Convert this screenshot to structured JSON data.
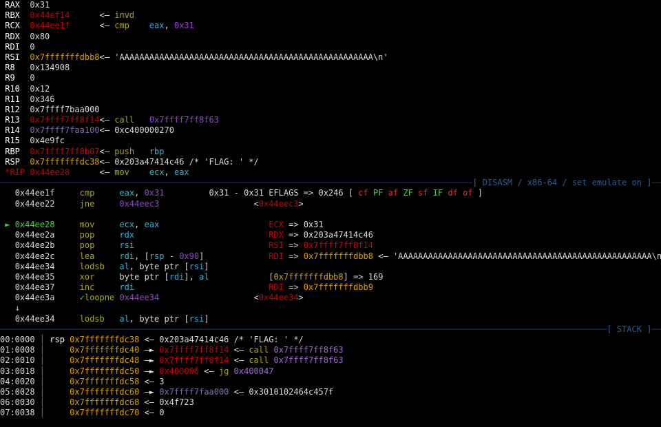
{
  "terminal": {
    "title": "pwndbg context view",
    "background": "#000000",
    "foreground": "#d8d8d8",
    "colors": {
      "red": "#cc0000",
      "bright_red": "#ff2222",
      "green": "#4ca64c",
      "bright_green": "#33dd33",
      "yellow": "#c4a000",
      "olive": "#a8a800",
      "blue": "#3465a4",
      "cyan": "#2fb3d9",
      "purple": "#9a3fd4",
      "dim_purple": "#7c6fa8",
      "separator": "#1e3a5f"
    }
  },
  "registers": {
    "rows": [
      {
        "name": "RAX",
        "value": "0x31",
        "value_color": "white",
        "arrow": "",
        "annotation": ""
      },
      {
        "name": "RBX",
        "value": "0x44ef14",
        "value_color": "red",
        "arrow": "<—",
        "annotation": "invd"
      },
      {
        "name": "RCX",
        "value": "0x44ee1f",
        "value_color": "red",
        "arrow": "<—",
        "annotation": "cmp    eax, 0x31"
      },
      {
        "name": "RDX",
        "value": "0x80",
        "value_color": "white",
        "arrow": "",
        "annotation": ""
      },
      {
        "name": "RDI",
        "value": "0",
        "value_color": "white",
        "arrow": "",
        "annotation": ""
      },
      {
        "name": "RSI",
        "value": "0x7fffffffdbb8",
        "value_color": "yellow",
        "arrow": "<—",
        "annotation": "'AAAAAAAAAAAAAAAAAAAAAAAAAAAAAAAAAAAAAAAAAAAAAAAAAAA\\n'"
      },
      {
        "name": "R8",
        "value": "0x134908",
        "value_color": "white",
        "arrow": "",
        "annotation": ""
      },
      {
        "name": "R9",
        "value": "0",
        "value_color": "white",
        "arrow": "",
        "annotation": ""
      },
      {
        "name": "R10",
        "value": "0x12",
        "value_color": "white",
        "arrow": "",
        "annotation": ""
      },
      {
        "name": "R11",
        "value": "0x346",
        "value_color": "white",
        "arrow": "",
        "annotation": ""
      },
      {
        "name": "R12",
        "value": "0x7ffff7baa000",
        "value_color": "white",
        "arrow": "",
        "annotation": ""
      },
      {
        "name": "R13",
        "value": "0x7ffff7ff8f14",
        "value_color": "red",
        "arrow": "<—",
        "annotation": "call   0x7ffff7ff8f63"
      },
      {
        "name": "R14",
        "value": "0x7ffff7faa100",
        "value_color": "dim_purple",
        "arrow": "<—",
        "annotation": "0xc400000270"
      },
      {
        "name": "R15",
        "value": "0x4e9fc",
        "value_color": "white",
        "arrow": "",
        "annotation": ""
      },
      {
        "name": "RBP",
        "value": "0x7ffff7ff8b07",
        "value_color": "red",
        "arrow": "<—",
        "annotation": "push   rbp"
      },
      {
        "name": "RSP",
        "value": "0x7fffffffdc38",
        "value_color": "yellow",
        "arrow": "<—",
        "annotation": "0x203a47414c46 /* 'FLAG: ' */"
      },
      {
        "name": "*RIP",
        "value": "0x44ee28",
        "value_color": "red",
        "arrow": "<—",
        "annotation": "mov    ecx, eax"
      }
    ]
  },
  "disasm": {
    "section_label": "[ DISASM / x86-64 / set emulate on ]",
    "eflags": {
      "label": "EFLAGS =>",
      "value": "0x246",
      "flags": [
        {
          "name": "cf",
          "set": false
        },
        {
          "name": "PF",
          "set": true
        },
        {
          "name": "af",
          "set": false
        },
        {
          "name": "ZF",
          "set": true
        },
        {
          "name": "sf",
          "set": false
        },
        {
          "name": "IF",
          "set": true
        },
        {
          "name": "df",
          "set": false
        },
        {
          "name": "of",
          "set": false
        }
      ]
    },
    "lines": [
      {
        "marker": "",
        "address": "0x44ee1f",
        "mnemonic": "cmp",
        "operands": "eax, 0x31",
        "comment": "0x31 - 0x31",
        "annotation": "EFLAGS",
        "current": false,
        "taken": false,
        "spacer_before": false
      },
      {
        "marker": "",
        "address": "0x44ee22",
        "mnemonic": "jne",
        "operands": "0x44eec3",
        "comment": "",
        "annotation": "<0x44eec3>",
        "current": false,
        "taken": false,
        "spacer_before": false
      },
      {
        "marker": "►",
        "address": "0x44ee28",
        "mnemonic": "mov",
        "operands": "ecx, eax",
        "comment": "",
        "annotation": "ECX => 0x31",
        "current": true,
        "taken": false,
        "spacer_before": true
      },
      {
        "marker": "",
        "address": "0x44ee2a",
        "mnemonic": "pop",
        "operands": "rdx",
        "comment": "",
        "annotation": "RDX => 0x203a47414c46",
        "current": false,
        "taken": false,
        "spacer_before": false
      },
      {
        "marker": "",
        "address": "0x44ee2b",
        "mnemonic": "pop",
        "operands": "rsi",
        "comment": "",
        "annotation": "RSI => 0x7ffff7ff8f14",
        "current": false,
        "taken": false,
        "spacer_before": false
      },
      {
        "marker": "",
        "address": "0x44ee2c",
        "mnemonic": "lea",
        "operands": "rdi, [rsp - 0x90]",
        "comment": "",
        "annotation": "RDI => 0x7fffffffdbb8 <— 'AAAAAAAAAAAAAAAAAAAAAAAAAAAAAAAAAAAAAAAAAAAAAAAAAAA\\n'",
        "current": false,
        "taken": false,
        "spacer_before": false
      },
      {
        "marker": "",
        "address": "0x44ee34",
        "mnemonic": "lodsb",
        "operands": "al, byte ptr [rsi]",
        "comment": "",
        "annotation": "",
        "current": false,
        "taken": false,
        "spacer_before": false
      },
      {
        "marker": "",
        "address": "0x44ee35",
        "mnemonic": "xor",
        "operands": "byte ptr [rdi], al",
        "comment": "",
        "annotation": "[0x7fffffffdbb8] => 169",
        "current": false,
        "taken": false,
        "spacer_before": false
      },
      {
        "marker": "",
        "address": "0x44ee37",
        "mnemonic": "inc",
        "operands": "rdi",
        "comment": "",
        "annotation": "RDI => 0x7fffffffdbb9",
        "current": false,
        "taken": false,
        "spacer_before": false
      },
      {
        "marker": "✓",
        "address": "0x44ee3a",
        "mnemonic": "loopne",
        "operands": "0x44ee34",
        "comment": "",
        "annotation": "<0x44ee34>",
        "current": false,
        "taken": true,
        "spacer_before": false
      },
      {
        "marker": "↓",
        "address": "",
        "mnemonic": "",
        "operands": "",
        "comment": "",
        "annotation": "",
        "current": false,
        "taken": false,
        "spacer_before": false
      },
      {
        "marker": "",
        "address": "0x44ee34",
        "mnemonic": "lodsb",
        "operands": "al, byte ptr [rsi]",
        "comment": "",
        "annotation": "",
        "current": false,
        "taken": false,
        "spacer_before": false
      }
    ]
  },
  "stack": {
    "section_label": "[ STACK ]",
    "rows": [
      {
        "index": "00:0000",
        "reg": "rsp",
        "address": "0x7fffffffdc38",
        "arrow": "<—",
        "value": "0x203a47414c46",
        "value_color": "white",
        "comment": "/* 'FLAG: ' */",
        "chain_arrow": "",
        "chain_value": "",
        "chain_annot": ""
      },
      {
        "index": "01:0008",
        "reg": "",
        "address": "0x7fffffffdc40",
        "arrow": "—►",
        "value": "0x7ffff7ff8f14",
        "value_color": "red",
        "comment": "",
        "chain_arrow": "<—",
        "chain_value": "call",
        "chain_annot": "0x7ffff7ff8f63"
      },
      {
        "index": "02:0010",
        "reg": "",
        "address": "0x7fffffffdc48",
        "arrow": "—►",
        "value": "0x7ffff7ff8f14",
        "value_color": "red",
        "comment": "",
        "chain_arrow": "<—",
        "chain_value": "call",
        "chain_annot": "0x7ffff7ff8f63"
      },
      {
        "index": "03:0018",
        "reg": "",
        "address": "0x7fffffffdc50",
        "arrow": "—►",
        "value": "0x400000",
        "value_color": "red",
        "comment": "",
        "chain_arrow": "<—",
        "chain_value": "jg",
        "chain_annot": "0x400047"
      },
      {
        "index": "04:0020",
        "reg": "",
        "address": "0x7fffffffdc58",
        "arrow": "<—",
        "value": "3",
        "value_color": "white",
        "comment": "",
        "chain_arrow": "",
        "chain_value": "",
        "chain_annot": ""
      },
      {
        "index": "05:0028",
        "reg": "",
        "address": "0x7fffffffdc60",
        "arrow": "—►",
        "value": "0x7ffff7faa000",
        "value_color": "dim_purple",
        "comment": "",
        "chain_arrow": "<—",
        "chain_value": "",
        "chain_annot": "0x3010102464c457f"
      },
      {
        "index": "06:0030",
        "reg": "",
        "address": "0x7fffffffdc68",
        "arrow": "<—",
        "value": "0x4f723",
        "value_color": "white",
        "comment": "",
        "chain_arrow": "",
        "chain_value": "",
        "chain_annot": ""
      },
      {
        "index": "07:0038",
        "reg": "",
        "address": "0x7fffffffdc70",
        "arrow": "<—",
        "value": "0",
        "value_color": "white",
        "comment": "",
        "chain_arrow": "",
        "chain_value": "",
        "chain_annot": ""
      }
    ]
  }
}
